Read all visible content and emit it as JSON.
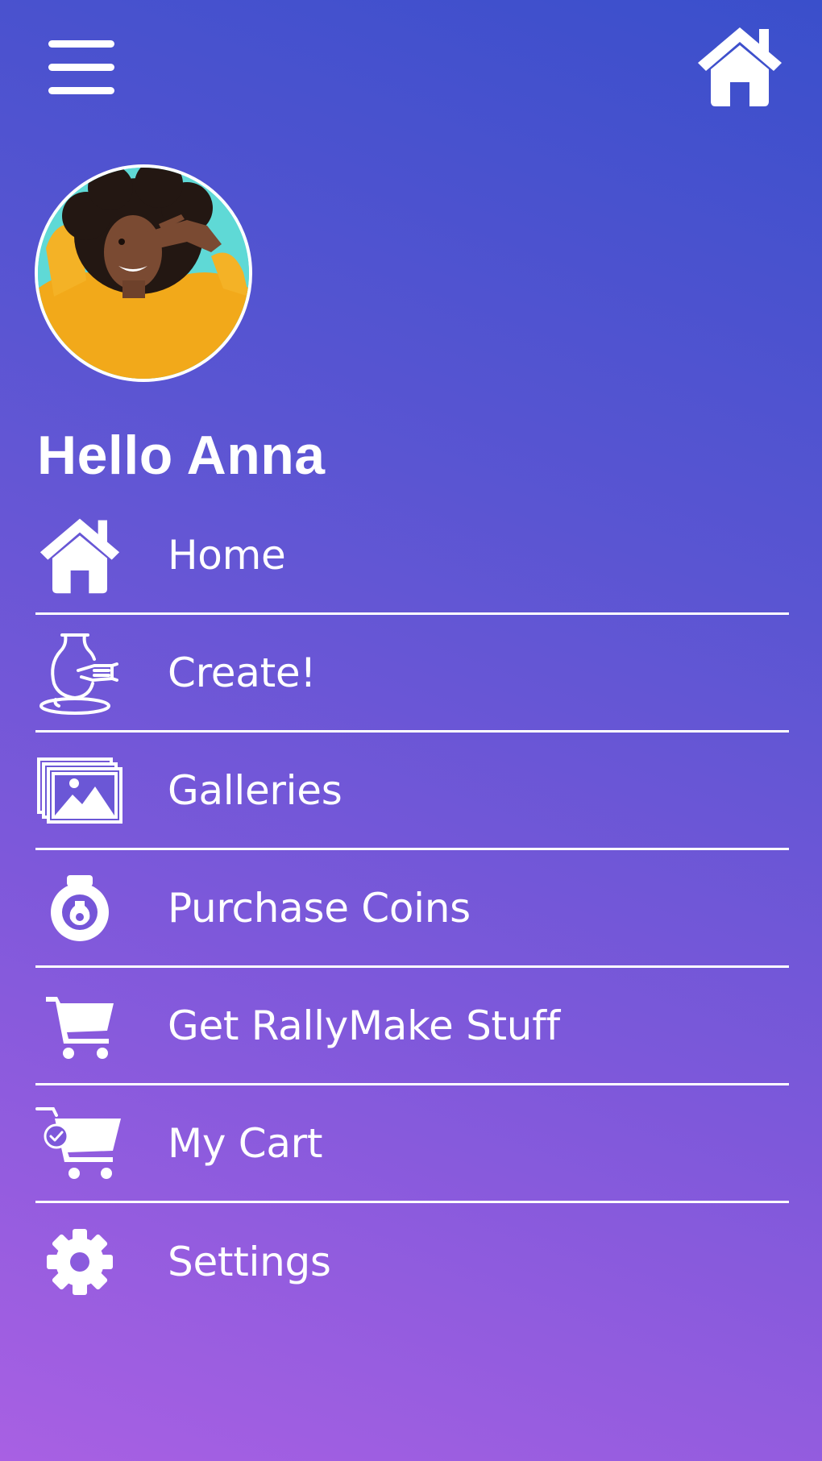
{
  "header": {
    "menu_icon": "hamburger-menu-icon",
    "home_icon": "home-icon"
  },
  "profile": {
    "greeting": "Hello Anna"
  },
  "menu": {
    "items": [
      {
        "label": "Home",
        "icon": "home-icon"
      },
      {
        "label": "Create!",
        "icon": "pottery-wheel-icon"
      },
      {
        "label": "Galleries",
        "icon": "gallery-images-icon"
      },
      {
        "label": "Purchase Coins",
        "icon": "coin-icon"
      },
      {
        "label": "Get RallyMake Stuff",
        "icon": "shopping-cart-icon"
      },
      {
        "label": "My Cart",
        "icon": "cart-check-icon"
      },
      {
        "label": "Settings",
        "icon": "gear-icon"
      }
    ]
  },
  "colors": {
    "gradient_top": "#3a4fcb",
    "gradient_bottom": "#a860e3",
    "foreground": "#ffffff"
  }
}
